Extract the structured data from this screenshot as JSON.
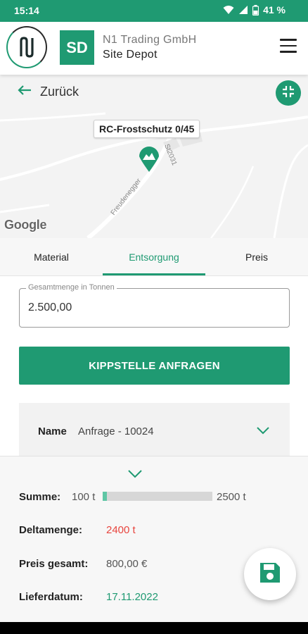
{
  "status_bar": {
    "time": "15:14",
    "battery": "41 %"
  },
  "header": {
    "avatar_initials": "SD",
    "company": "N1 Trading GmbH",
    "depot": "Site Depot"
  },
  "map": {
    "back_label": "Zurück",
    "marker_label": "RC-Frostschutz 0/45",
    "street_1": "Freudenegger",
    "street_2": "St2031",
    "attribution": "Google"
  },
  "tabs": [
    {
      "label": "Material",
      "active": false
    },
    {
      "label": "Entsorgung",
      "active": true
    },
    {
      "label": "Preis",
      "active": false
    }
  ],
  "form": {
    "quantity_label": "Gesamtmenge in Tonnen",
    "quantity_value": "2.500,00",
    "request_button": "KIPPSTELLE ANFRAGEN"
  },
  "accordion": {
    "key": "Name",
    "value": "Anfrage - 10024"
  },
  "summary": {
    "sum_label": "Summe:",
    "sum_min": "100 t",
    "sum_max": "2500 t",
    "sum_progress": 0.04,
    "delta_label": "Deltamenge:",
    "delta_value": "2400 t",
    "price_label": "Preis gesamt:",
    "price_value": "800,00 €",
    "date_label": "Lieferdatum:",
    "date_value": "17.11.2022"
  },
  "colors": {
    "brand": "#1f9a72",
    "delta": "#e8463f",
    "progress": "#5fc6a5"
  },
  "icons": [
    "wifi-icon",
    "signal-icon",
    "battery-icon",
    "menu-icon",
    "arrow-left-icon",
    "collapse-icon",
    "map-marker-icon",
    "chevron-down-icon",
    "save-icon"
  ]
}
